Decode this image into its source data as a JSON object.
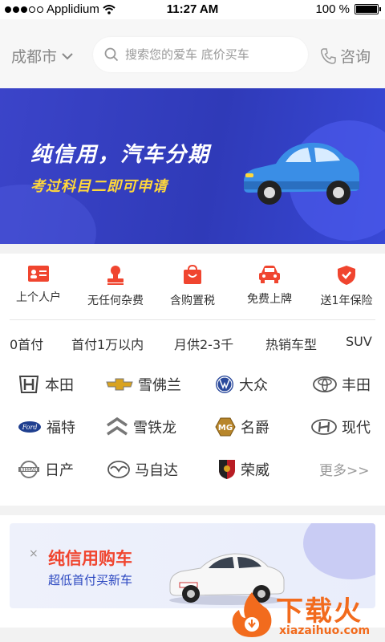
{
  "status_bar": {
    "carrier": "Applidium",
    "time": "11:27 AM",
    "battery": "100 %"
  },
  "header": {
    "city": "成都市",
    "search_placeholder": "搜索您的爱车 底价买车",
    "consult_label": "咨询"
  },
  "banner": {
    "title": "纯信用，汽车分期",
    "subtitle": "考过科目二即可申请"
  },
  "services": [
    {
      "label": "上个人户",
      "icon": "id-card-icon"
    },
    {
      "label": "无任何杂费",
      "icon": "stamp-icon"
    },
    {
      "label": "含购置税",
      "icon": "shopping-bag-icon"
    },
    {
      "label": "免费上牌",
      "icon": "car-icon"
    },
    {
      "label": "送1年保险",
      "icon": "shield-check-icon"
    }
  ],
  "filters": [
    "0首付",
    "首付1万以内",
    "月供2-3千",
    "热销车型",
    "SUV"
  ],
  "brands": [
    {
      "name": "本田",
      "icon": "honda-logo-icon"
    },
    {
      "name": "雪佛兰",
      "icon": "chevrolet-logo-icon"
    },
    {
      "name": "大众",
      "icon": "volkswagen-logo-icon"
    },
    {
      "name": "丰田",
      "icon": "toyota-logo-icon"
    },
    {
      "name": "福特",
      "icon": "ford-logo-icon"
    },
    {
      "name": "雪铁龙",
      "icon": "citroen-logo-icon"
    },
    {
      "name": "名爵",
      "icon": "mg-logo-icon"
    },
    {
      "name": "现代",
      "icon": "hyundai-logo-icon"
    },
    {
      "name": "日产",
      "icon": "nissan-logo-icon"
    },
    {
      "name": "马自达",
      "icon": "mazda-logo-icon"
    },
    {
      "name": "荣威",
      "icon": "roewe-logo-icon"
    }
  ],
  "more_label": "更多>>",
  "promo_card": {
    "title": "纯信用购车",
    "subtitle": "超低首付买新车",
    "close": "×"
  },
  "watermark": {
    "text": "下载火",
    "url": "xiazaihuo.com"
  },
  "colors": {
    "accent": "#f0452f",
    "banner": "#3b44c9",
    "brand_blue": "#2b47c0"
  }
}
